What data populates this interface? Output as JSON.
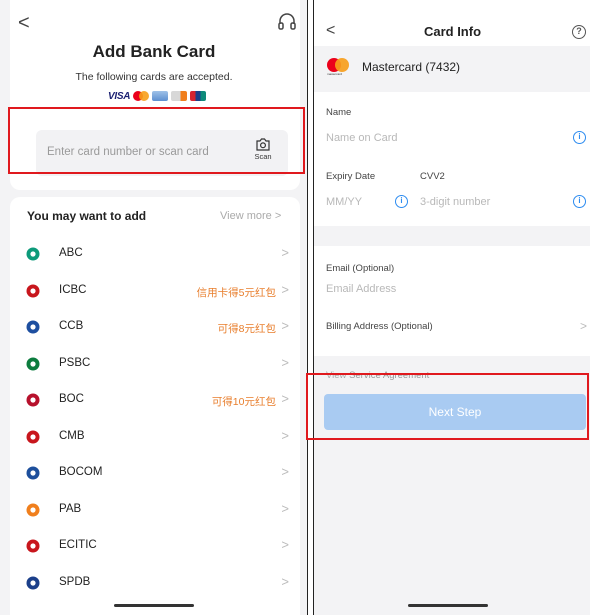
{
  "left": {
    "title": "Add Bank Card",
    "subtitle": "The following cards are accepted.",
    "accepted_logos": {
      "visa": "VISA"
    },
    "card_input": {
      "placeholder": "Enter card number or scan card",
      "scan_label": "Scan"
    },
    "list": {
      "heading": "You may want to add",
      "view_more": "View more",
      "banks": [
        {
          "name": "ABC",
          "promo": "",
          "icon": "abc-bank-icon",
          "color": "#0d9a7a"
        },
        {
          "name": "ICBC",
          "promo": "信用卡得5元红包",
          "icon": "icbc-bank-icon",
          "color": "#c8161d"
        },
        {
          "name": "CCB",
          "promo": "可得8元红包",
          "icon": "ccb-bank-icon",
          "color": "#1e4fa0"
        },
        {
          "name": "PSBC",
          "promo": "",
          "icon": "psbc-bank-icon",
          "color": "#0c7c3e"
        },
        {
          "name": "BOC",
          "promo": "可得10元红包",
          "icon": "boc-bank-icon",
          "color": "#b7112c"
        },
        {
          "name": "CMB",
          "promo": "",
          "icon": "cmb-bank-icon",
          "color": "#c8161d"
        },
        {
          "name": "BOCOM",
          "promo": "",
          "icon": "bocom-bank-icon",
          "color": "#1d4f9c"
        },
        {
          "name": "PAB",
          "promo": "",
          "icon": "pab-bank-icon",
          "color": "#f07f1d"
        },
        {
          "name": "ECITIC",
          "promo": "",
          "icon": "ecitic-bank-icon",
          "color": "#c8161d"
        },
        {
          "name": "SPDB",
          "promo": "",
          "icon": "spdb-bank-icon",
          "color": "#1b3f8a"
        }
      ]
    }
  },
  "right": {
    "title": "Card Info",
    "card_brand": "Mastercard (7432)",
    "mc_logo_text": "mastercard",
    "name": {
      "label": "Name",
      "placeholder": "Name on Card"
    },
    "expiry": {
      "label": "Expiry Date",
      "placeholder": "MM/YY"
    },
    "cvv": {
      "label": "CVV2",
      "placeholder": "3-digit number"
    },
    "email": {
      "label": "Email (Optional)",
      "placeholder": "Email Address"
    },
    "billing": {
      "label": "Billing Address (Optional)"
    },
    "agreement": {
      "prefix": "View",
      "link": "Service Agreement"
    },
    "next_label": "Next Step"
  },
  "colors": {
    "accent_red": "#e0191e",
    "button_blue": "#a9cbf2",
    "info_blue": "#2d8cf0",
    "promo_orange": "#e87e2c"
  },
  "icons": {
    "back": "<",
    "chevron": ">",
    "help": "?",
    "info": "i"
  }
}
